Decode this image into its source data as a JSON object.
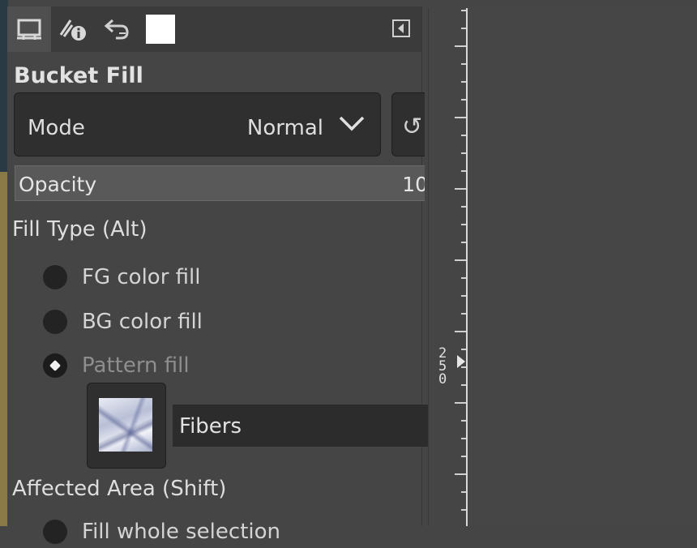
{
  "tabs": [
    {
      "name": "tool-options",
      "icon": "tool-options-icon"
    },
    {
      "name": "device-status",
      "icon": "device-status-icon"
    },
    {
      "name": "undo-history",
      "icon": "undo-history-icon"
    },
    {
      "name": "images",
      "icon": "image-thumbnail-icon"
    }
  ],
  "panel": {
    "title": "Bucket Fill",
    "mode_label": "Mode",
    "mode_value": "Normal",
    "opacity_label": "Opacity",
    "opacity_value": "10",
    "fill_type_label": "Fill Type  (Alt)",
    "fill_options": [
      "FG color fill",
      "BG color fill",
      "Pattern fill"
    ],
    "pattern_name": "Fibers",
    "affected_area_label": "Affected Area  (Shift)",
    "affected_option_partial": "Fill whole selection"
  },
  "ruler": {
    "label": "250"
  },
  "colors": {
    "panel_bg": "#454545",
    "field_bg": "#2f2f2f",
    "accent_white": "#ffffff"
  }
}
